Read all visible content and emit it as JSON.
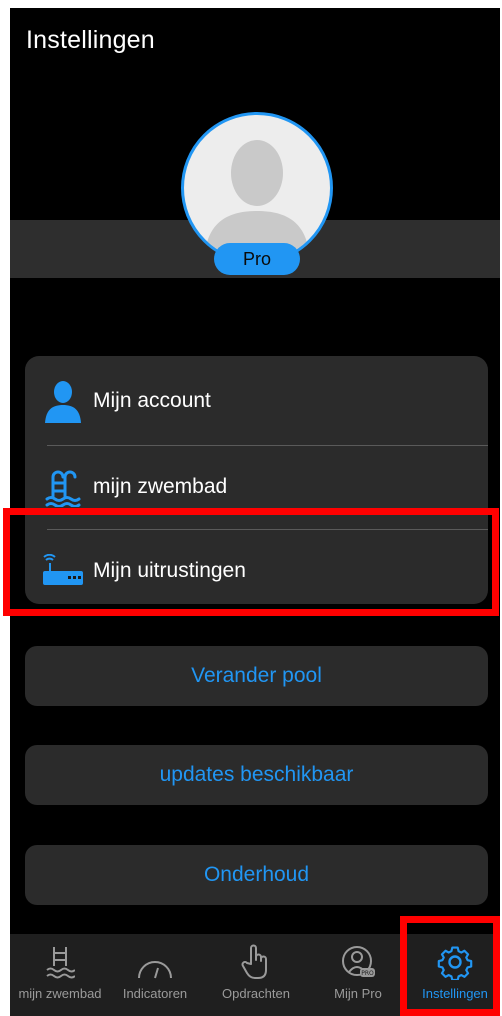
{
  "header": {
    "title": "Instellingen"
  },
  "profile": {
    "badge": "Pro",
    "avatar_icon": "person-silhouette-icon"
  },
  "menu": {
    "items": [
      {
        "label": "Mijn account",
        "icon": "person-icon"
      },
      {
        "label": "mijn zwembad",
        "icon": "pool-ladder-icon"
      },
      {
        "label": "Mijn uitrustingen",
        "icon": "router-device-icon"
      }
    ]
  },
  "actions": {
    "change_pool": "Verander pool",
    "updates": "updates beschikbaar",
    "maintenance": "Onderhoud"
  },
  "tabbar": {
    "tabs": [
      {
        "label": "mijn zwembad",
        "icon": "pool-icon"
      },
      {
        "label": "Indicatoren",
        "icon": "gauge-icon"
      },
      {
        "label": "Opdrachten",
        "icon": "hand-pointer-icon"
      },
      {
        "label": "Mijn Pro",
        "icon": "pro-person-icon"
      },
      {
        "label": "Instellingen",
        "icon": "gear-icon"
      }
    ],
    "active": "Instellingen"
  },
  "colors": {
    "accent": "#2196f3",
    "highlight": "#ff0000",
    "background": "#000000",
    "card": "#2b2b2b"
  }
}
